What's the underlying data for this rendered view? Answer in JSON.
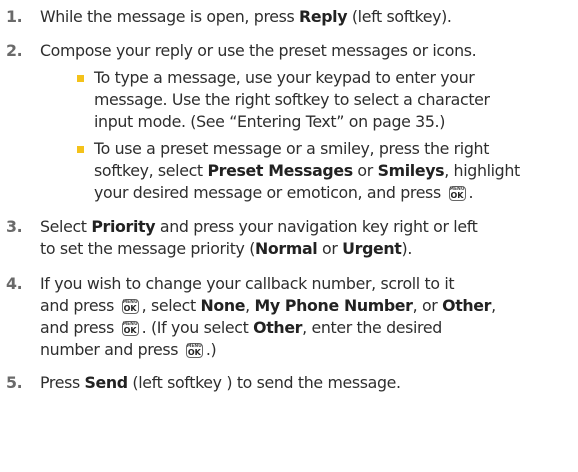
{
  "key": {
    "top": "MENU",
    "bottom": "OK"
  },
  "steps": [
    {
      "number": "1.",
      "parts": [
        "While the message is open, press ",
        "Reply",
        " (left softkey)."
      ]
    },
    {
      "number": "2.",
      "text": "Compose your reply or use the preset messages or icons."
    },
    {
      "number": "3.",
      "lines": [
        [
          "Select ",
          "Priority",
          " and press your navigation key right or left"
        ],
        [
          "to set the message priority (",
          "Normal",
          " or ",
          "Urgent",
          ")."
        ]
      ]
    },
    {
      "number": "4.",
      "lines": [
        [
          "If you wish to change your callback number, scroll to it"
        ],
        [
          "and press ",
          ", select ",
          "None",
          ", ",
          "My Phone Number",
          ", or ",
          "Other",
          ","
        ],
        [
          "and press ",
          ". (If you select ",
          "Other",
          ", enter the desired"
        ],
        [
          "number and press ",
          ".)"
        ]
      ]
    },
    {
      "number": "5.",
      "parts": [
        "Press ",
        "Send",
        " (left softkey ) to send the message."
      ]
    }
  ],
  "bullets": [
    {
      "lines": [
        [
          "To type a message, use your keypad to enter your"
        ],
        [
          "message. Use the right softkey to select a character"
        ],
        [
          "input mode. (See “Entering Text” on page 35.)"
        ]
      ]
    },
    {
      "lines": [
        [
          "To use a preset message or a smiley, press the right"
        ],
        [
          "softkey, select ",
          "Preset Messages",
          " or ",
          "Smileys",
          ", highlight"
        ],
        [
          "your desired message or emoticon, and press ",
          "."
        ]
      ]
    }
  ]
}
